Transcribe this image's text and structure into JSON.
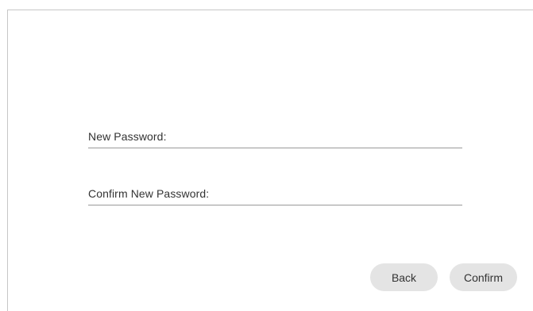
{
  "form": {
    "new_password_label": "New Password:",
    "confirm_password_label": "Confirm New Password:",
    "new_password_value": "",
    "confirm_password_value": ""
  },
  "actions": {
    "back_label": "Back",
    "confirm_label": "Confirm"
  }
}
